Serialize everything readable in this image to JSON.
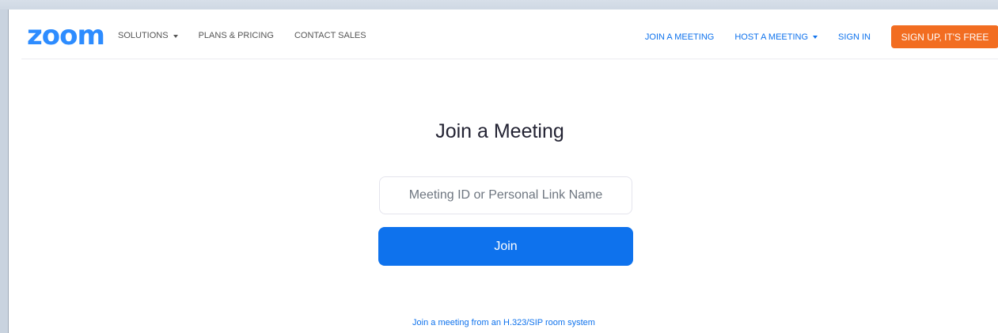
{
  "brand": {
    "logo_text": "zoom",
    "accent_color": "#2d8cff",
    "link_color": "#0e72ed",
    "signup_color": "#f26d21"
  },
  "nav": {
    "left_items": [
      {
        "label": "SOLUTIONS",
        "has_dropdown": true
      },
      {
        "label": "PLANS & PRICING",
        "has_dropdown": false
      },
      {
        "label": "CONTACT SALES",
        "has_dropdown": false
      }
    ],
    "right_items": [
      {
        "label": "JOIN A MEETING",
        "has_dropdown": false
      },
      {
        "label": "HOST A MEETING",
        "has_dropdown": true
      },
      {
        "label": "SIGN IN",
        "has_dropdown": false
      }
    ],
    "signup_label": "SIGN UP, IT'S FREE"
  },
  "main": {
    "title": "Join a Meeting",
    "meeting_input": {
      "placeholder": "Meeting ID or Personal Link Name",
      "value": ""
    },
    "join_label": "Join",
    "h323_link": "Join a meeting from an H.323/SIP room system"
  }
}
